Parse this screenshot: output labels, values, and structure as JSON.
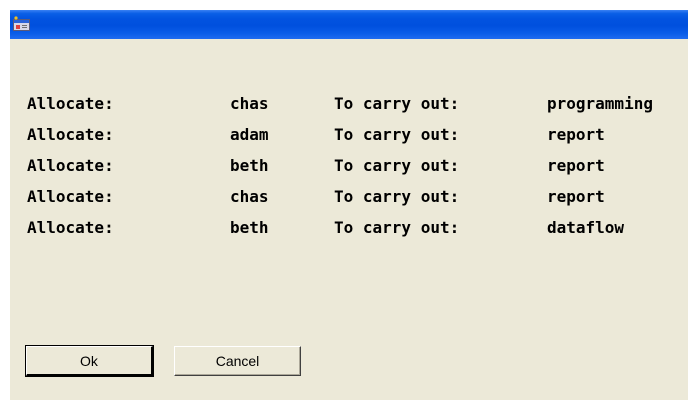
{
  "window": {
    "title": "",
    "titlebar_color": "#0050de",
    "background_color": "#ece9d8",
    "icon": "app-window-icon"
  },
  "assignments": [
    {
      "verb": "Allocate:",
      "name": "chas",
      "task_label": "To carry out:",
      "task": "programming"
    },
    {
      "verb": "Allocate:",
      "name": "adam",
      "task_label": "To carry out:",
      "task": "report"
    },
    {
      "verb": "Allocate:",
      "name": "beth",
      "task_label": "To carry out:",
      "task": "report"
    },
    {
      "verb": "Allocate:",
      "name": "chas",
      "task_label": "To carry out:",
      "task": "report"
    },
    {
      "verb": "Allocate:",
      "name": "beth",
      "task_label": "To carry out:",
      "task": "dataflow"
    }
  ],
  "buttons": {
    "ok_label": "Ok",
    "cancel_label": "Cancel"
  }
}
